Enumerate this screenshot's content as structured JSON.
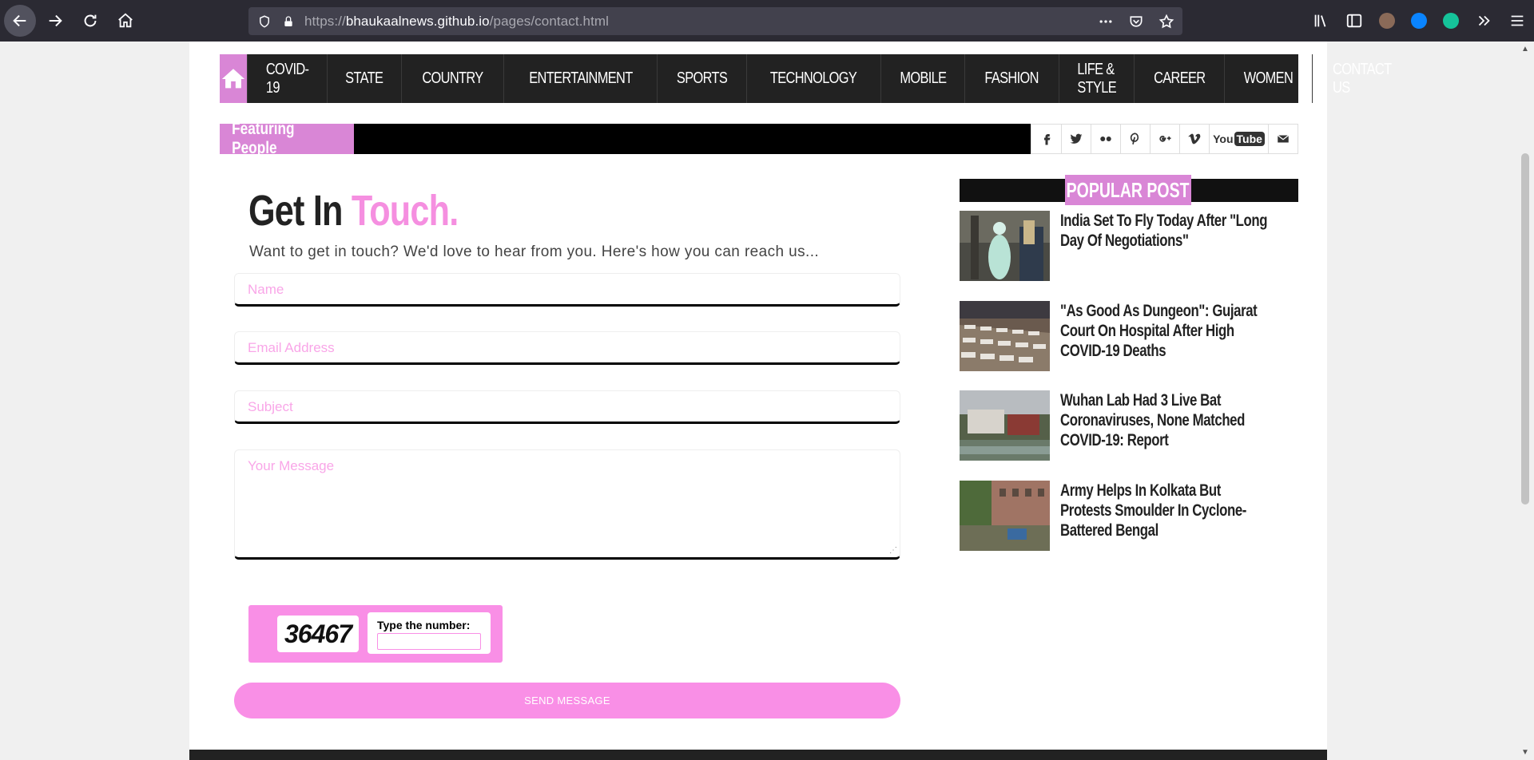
{
  "browser": {
    "url_prefix": "https://",
    "url_host": "bhaukaalnews.github.io",
    "url_path": "/pages/contact.html"
  },
  "nav": {
    "items": [
      "COVID-19",
      "STATE",
      "COUNTRY",
      "ENTERTAINMENT",
      "SPORTS",
      "TECHNOLOGY",
      "MOBILE",
      "FASHION",
      "LIFE & STYLE",
      "CAREER",
      "WOMEN",
      "CONTACT US"
    ]
  },
  "ticker": {
    "label": "Featuring People",
    "social": {
      "youtube_you": "You",
      "youtube_tube": "Tube"
    }
  },
  "contact": {
    "title_a": "Get In",
    "title_b": "Touch.",
    "subtitle": "Want to get in touch? We'd love to hear from you. Here's how you can reach us...",
    "name_placeholder": "Name",
    "email_placeholder": "Email Address",
    "subject_placeholder": "Subject",
    "message_placeholder": "Your Message",
    "captcha_code": "36467",
    "captcha_label": "Type the number:",
    "send_label": "SEND MESSAGE"
  },
  "sidebar": {
    "heading": "POPULAR POST",
    "posts": [
      {
        "title": "India Set To Fly Today After \"Long Day Of Negotiations\""
      },
      {
        "title": "\"As Good As Dungeon\": Gujarat Court On Hospital After High COVID-19 Deaths"
      },
      {
        "title": "Wuhan Lab Had 3 Live Bat Coronaviruses, None Matched COVID-19: Report"
      },
      {
        "title": "Army Helps In Kolkata But Protests Smoulder In Cyclone-Battered Bengal"
      }
    ]
  },
  "colors": {
    "accent": "#d986d6",
    "pink_light": "#f98fe6",
    "nav_bg": "#222222"
  }
}
